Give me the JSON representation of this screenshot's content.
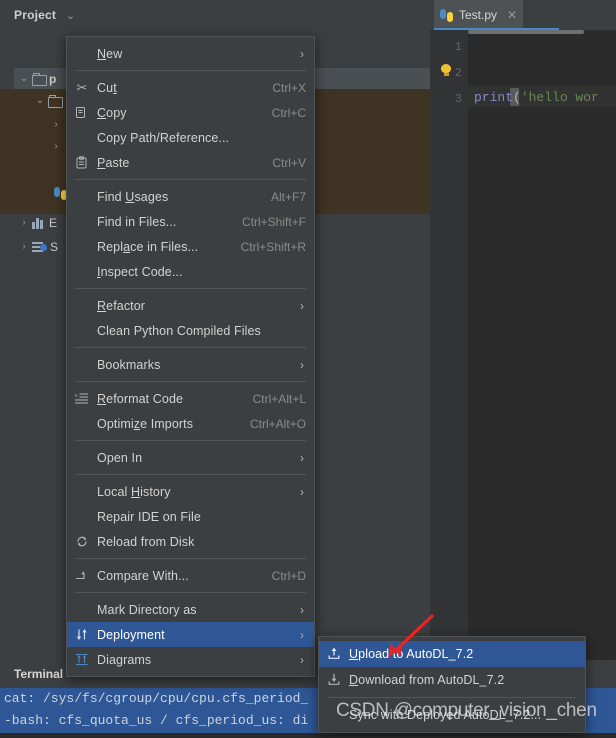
{
  "project": {
    "title": "Project",
    "caret_icon": "chevron-down-icon",
    "tree": [
      {
        "label": "p",
        "twisty": "⌄",
        "icon": "folder-icon",
        "selected": true,
        "bold": true
      },
      {
        "label": "",
        "twisty": "⌄",
        "icon": "folder-icon",
        "selected": false,
        "bold": false
      },
      {
        "label": "",
        "twisty": "›",
        "icon": "",
        "selected": false,
        "bold": false
      },
      {
        "label": "",
        "twisty": "›",
        "icon": "",
        "selected": false,
        "bold": false
      },
      {
        "label": "E",
        "twisty": "›",
        "icon": "library-icon",
        "selected": false,
        "bold": false
      },
      {
        "label": "S",
        "twisty": "›",
        "icon": "scratches-icon",
        "selected": false,
        "bold": false
      }
    ]
  },
  "editor": {
    "tab_label": "Test.py",
    "tab_icon": "python-file-icon",
    "close_icon": "close-icon",
    "lines": [
      "1",
      "2",
      "3"
    ],
    "bulb_icon": "intention-bulb-icon",
    "code": {
      "fn": "print",
      "paren": "(",
      "string": "'hello wor"
    }
  },
  "terminal": {
    "tab_label": "Terminal",
    "line1": "cat: /sys/fs/cgroup/cpu/cpu.cfs_period_",
    "line2": "-bash: cfs_quota_us / cfs_period_us: di"
  },
  "context_menu": {
    "items": [
      {
        "type": "item",
        "label": "New",
        "mnemonic": "N",
        "shortcut": "",
        "arrow": true,
        "icon": ""
      },
      {
        "type": "separator"
      },
      {
        "type": "item",
        "label": "Cut",
        "mnemonic": "t",
        "shortcut": "Ctrl+X",
        "arrow": false,
        "icon": "scissors-icon"
      },
      {
        "type": "item",
        "label": "Copy",
        "mnemonic": "C",
        "shortcut": "Ctrl+C",
        "arrow": false,
        "icon": "copy-icon"
      },
      {
        "type": "item",
        "label": "Copy Path/Reference...",
        "mnemonic": "",
        "shortcut": "",
        "arrow": false,
        "icon": ""
      },
      {
        "type": "item",
        "label": "Paste",
        "mnemonic": "P",
        "shortcut": "Ctrl+V",
        "arrow": false,
        "icon": "clipboard-icon"
      },
      {
        "type": "separator"
      },
      {
        "type": "item",
        "label": "Find Usages",
        "mnemonic": "U",
        "shortcut": "Alt+F7",
        "arrow": false,
        "icon": ""
      },
      {
        "type": "item",
        "label": "Find in Files...",
        "mnemonic": "",
        "shortcut": "Ctrl+Shift+F",
        "arrow": false,
        "icon": ""
      },
      {
        "type": "item",
        "label": "Replace in Files...",
        "mnemonic": "a",
        "shortcut": "Ctrl+Shift+R",
        "arrow": false,
        "icon": ""
      },
      {
        "type": "item",
        "label": "Inspect Code...",
        "mnemonic": "I",
        "shortcut": "",
        "arrow": false,
        "icon": ""
      },
      {
        "type": "separator"
      },
      {
        "type": "item",
        "label": "Refactor",
        "mnemonic": "R",
        "shortcut": "",
        "arrow": true,
        "icon": ""
      },
      {
        "type": "item",
        "label": "Clean Python Compiled Files",
        "mnemonic": "",
        "shortcut": "",
        "arrow": false,
        "icon": ""
      },
      {
        "type": "separator"
      },
      {
        "type": "item",
        "label": "Bookmarks",
        "mnemonic": "",
        "shortcut": "",
        "arrow": true,
        "icon": ""
      },
      {
        "type": "separator"
      },
      {
        "type": "item",
        "label": "Reformat Code",
        "mnemonic": "R",
        "shortcut": "Ctrl+Alt+L",
        "arrow": false,
        "icon": "reformat-icon"
      },
      {
        "type": "item",
        "label": "Optimize Imports",
        "mnemonic": "z",
        "shortcut": "Ctrl+Alt+O",
        "arrow": false,
        "icon": ""
      },
      {
        "type": "separator"
      },
      {
        "type": "item",
        "label": "Open In",
        "mnemonic": "",
        "shortcut": "",
        "arrow": true,
        "icon": ""
      },
      {
        "type": "separator"
      },
      {
        "type": "item",
        "label": "Local History",
        "mnemonic": "H",
        "shortcut": "",
        "arrow": true,
        "icon": ""
      },
      {
        "type": "item",
        "label": "Repair IDE on File",
        "mnemonic": "",
        "shortcut": "",
        "arrow": false,
        "icon": ""
      },
      {
        "type": "item",
        "label": "Reload from Disk",
        "mnemonic": "",
        "shortcut": "",
        "arrow": false,
        "icon": "reload-icon"
      },
      {
        "type": "separator"
      },
      {
        "type": "item",
        "label": "Compare With...",
        "mnemonic": "",
        "shortcut": "Ctrl+D",
        "arrow": false,
        "icon": "compare-icon"
      },
      {
        "type": "separator"
      },
      {
        "type": "item",
        "label": "Mark Directory as",
        "mnemonic": "",
        "shortcut": "",
        "arrow": true,
        "icon": ""
      },
      {
        "type": "item",
        "label": "Deployment",
        "mnemonic": "",
        "shortcut": "",
        "arrow": true,
        "icon": "deployment-icon",
        "selected": true
      },
      {
        "type": "item",
        "label": "Diagrams",
        "mnemonic": "",
        "shortcut": "",
        "arrow": true,
        "icon": "diagrams-icon"
      }
    ]
  },
  "submenu": {
    "items": [
      {
        "label": "Upload to AutoDL_7.2",
        "mnemonic": "U",
        "icon": "upload-icon",
        "selected": true
      },
      {
        "label": "Download from AutoDL_7.2",
        "mnemonic": "D",
        "icon": "download-icon",
        "selected": false
      },
      {
        "type": "separator"
      },
      {
        "label": "Sync with Deployed AutoDL_7.2...",
        "mnemonic": "S",
        "icon": "",
        "selected": false
      }
    ]
  },
  "annotation": {
    "arrow_color": "#ee2222"
  },
  "watermark": {
    "text": "CSDN @computer_vision_chen"
  },
  "colors": {
    "menu_bg": "#3c3f41",
    "selection_blue": "#2f5796",
    "panel_bg": "#3c3f41",
    "editor_bg": "#2b2b2b",
    "highlight_brown": "#3f3323"
  }
}
